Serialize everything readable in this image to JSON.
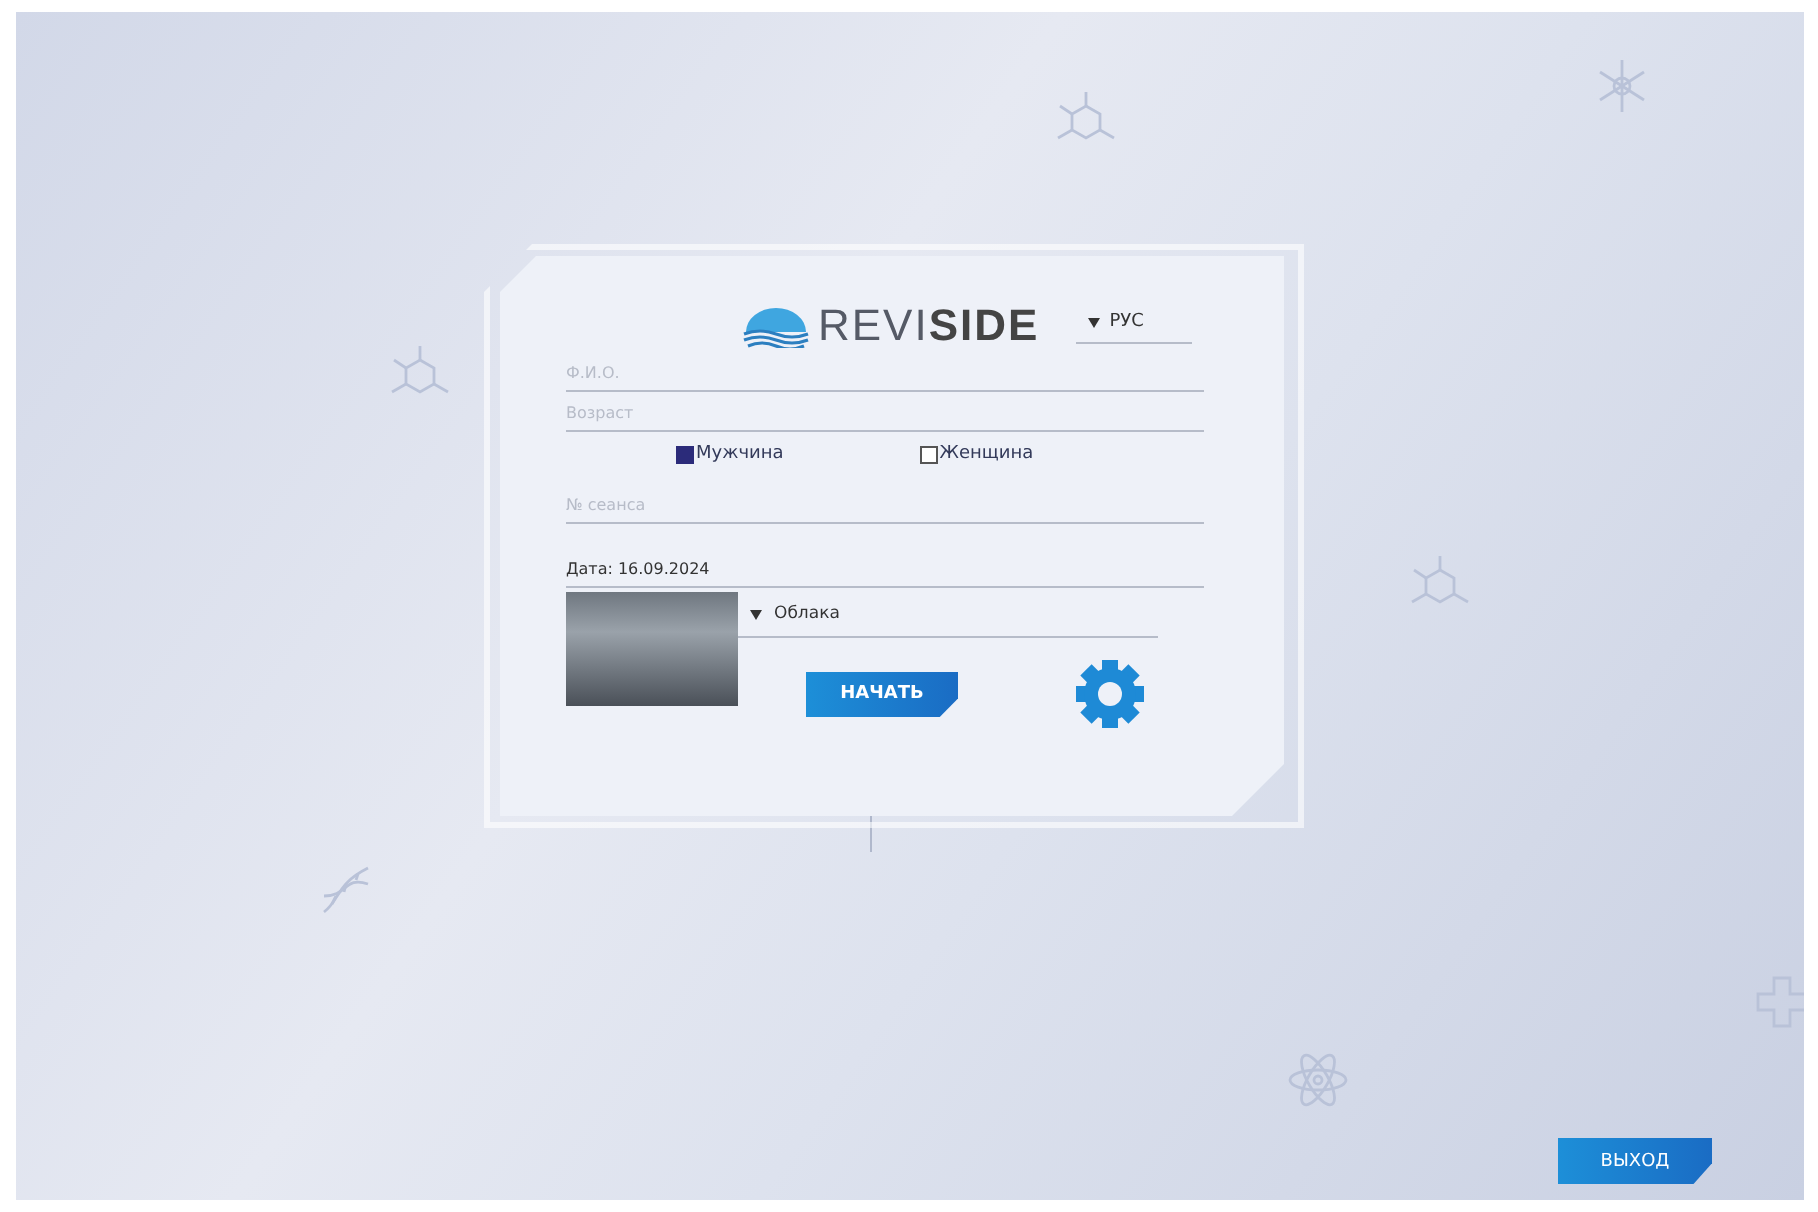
{
  "logo": {
    "text": "REVI**SIDE**"
  },
  "language": {
    "value": "РУС"
  },
  "fields": [
    {
      "placeholder": "Ф.И.О."
    },
    {
      "placeholder": "Возраст"
    }
  ],
  "gender": [
    {
      "label": "Мужчина",
      "selected": true
    },
    {
      "label": "Женщина",
      "selected": false
    }
  ],
  "session_field": {
    "placeholder": "№ сеанса"
  },
  "date": {
    "value": "Дата: 16.09.2024"
  },
  "scene": {
    "value": "Облака"
  },
  "start_button": "НАЧАТЬ",
  "exit_button": "ВЫХОД"
}
